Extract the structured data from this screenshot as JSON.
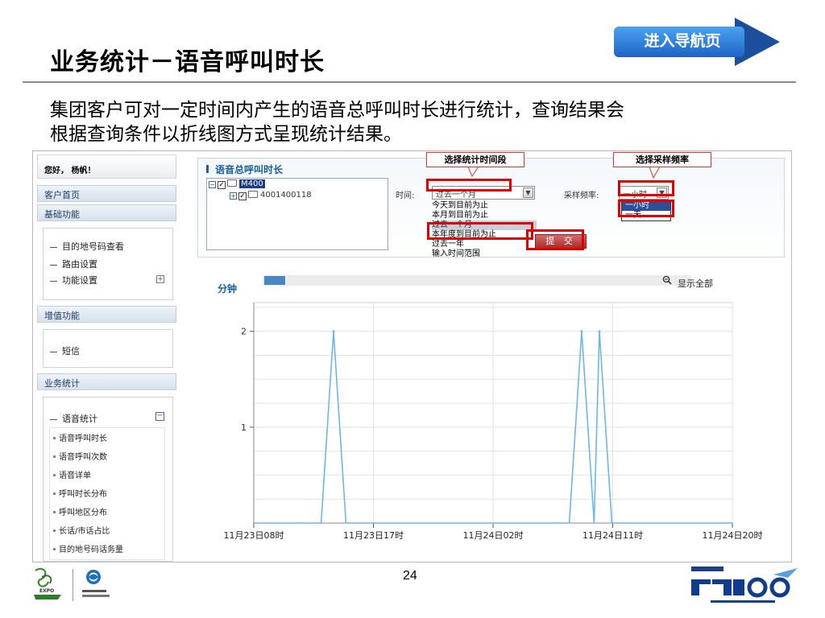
{
  "slide": {
    "title": "业务统计－语音呼叫时长",
    "nav_button": "进入导航页",
    "intro_line1": "集团客户可对一定时间内产生的语音总呼叫时长进行统计，查询结果会",
    "intro_line2": "根据查询条件以折线图方式呈现统计结果。",
    "page_number": "24"
  },
  "callouts": {
    "time_period": "选择统计时间段",
    "frequency": "选择采样频率"
  },
  "menu": {
    "greeting": "您好， 杨帆！",
    "home": "客户首页",
    "basic_header": "基础功能",
    "basic_items": [
      "目的地号码查看",
      "路由设置",
      "功能设置"
    ],
    "value_header": "增值功能",
    "value_items": [
      "短信"
    ],
    "stats_header": "业务统计",
    "stats_group": "语音统计",
    "stats_items": [
      "语音呼叫时长",
      "语音呼叫次数",
      "语音详单",
      "呼叫时长分布",
      "呼叫地区分布",
      "长话/市话占比",
      "目的地号码话务量"
    ]
  },
  "query": {
    "panel_title": "语音总呼叫时长",
    "tree_root": "M400",
    "tree_child": "4001400118",
    "time_label": "时间:",
    "time_selected": "过去一个月",
    "time_options": [
      "今天到目前为止",
      "本月到目前为止",
      "过去一个月",
      "本年度到目前为止",
      "过去一年",
      "输入时间范围"
    ],
    "freq_label": "采样频率:",
    "freq_selected": "一小时",
    "freq_options": [
      "一小时",
      "一天"
    ],
    "submit": "提 交"
  },
  "chart_data": {
    "type": "line",
    "title": "",
    "ylabel": "分钟",
    "xlabel": "",
    "ylim": [
      0,
      2.3
    ],
    "yticks": [
      "1",
      "2"
    ],
    "xticks": [
      "11月23日08时",
      "11月23日17时",
      "11月24日02时",
      "11月24日11时",
      "11月24日20时"
    ],
    "x_hours": [
      0,
      27
    ],
    "series": [
      {
        "points": [
          [
            0,
            0
          ],
          [
            3.8,
            0
          ],
          [
            4.5,
            2
          ],
          [
            5.2,
            0
          ],
          [
            17.8,
            0
          ],
          [
            18.5,
            2
          ],
          [
            19.2,
            0
          ],
          [
            19.5,
            2
          ],
          [
            20.2,
            0
          ],
          [
            27,
            0
          ]
        ]
      }
    ],
    "zoom_control": "显示全部",
    "line_color": "#6bb8e8",
    "grid": true
  }
}
